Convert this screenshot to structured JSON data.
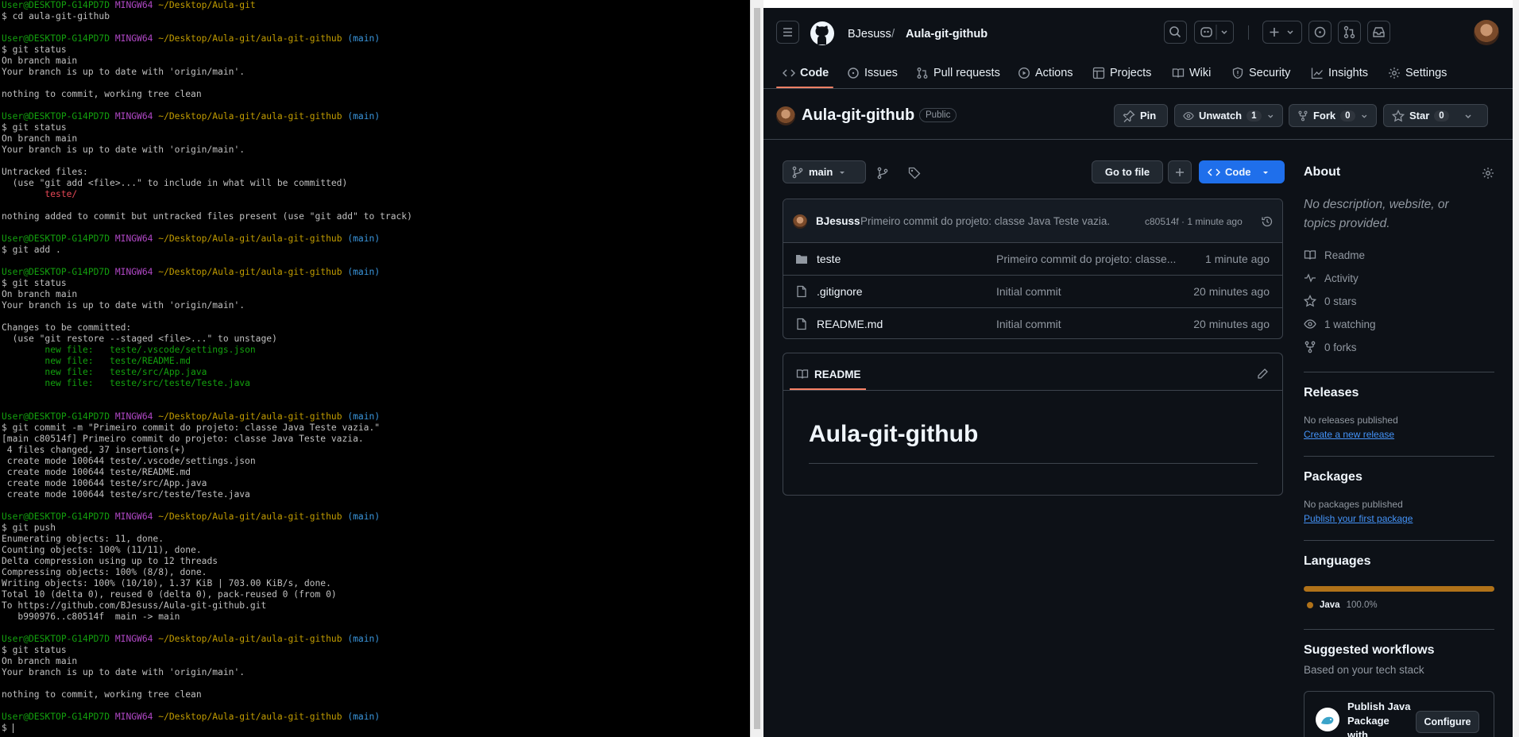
{
  "terminal": {
    "lines": [
      [
        {
          "t": "User@DESKTOP-G14PD7D",
          "c": "pg"
        },
        {
          "t": " "
        },
        {
          "t": "MINGW64",
          "c": "pp"
        },
        {
          "t": " "
        },
        {
          "t": "~/Desktop/Aula-git",
          "c": "py"
        }
      ],
      [
        {
          "t": "$ cd aula-git-github"
        }
      ],
      [
        {
          "t": ""
        }
      ],
      [
        {
          "t": "User@DESKTOP-G14PD7D",
          "c": "pg"
        },
        {
          "t": " "
        },
        {
          "t": "MINGW64",
          "c": "pp"
        },
        {
          "t": " "
        },
        {
          "t": "~/Desktop/Aula-git/aula-git-github",
          "c": "py"
        },
        {
          "t": " "
        },
        {
          "t": "(main)",
          "c": "pc"
        }
      ],
      [
        {
          "t": "$ git status"
        }
      ],
      [
        {
          "t": "On branch main"
        }
      ],
      [
        {
          "t": "Your branch is up to date with 'origin/main'."
        }
      ],
      [
        {
          "t": ""
        }
      ],
      [
        {
          "t": "nothing to commit, working tree clean"
        }
      ],
      [
        {
          "t": ""
        }
      ],
      [
        {
          "t": "User@DESKTOP-G14PD7D",
          "c": "pg"
        },
        {
          "t": " "
        },
        {
          "t": "MINGW64",
          "c": "pp"
        },
        {
          "t": " "
        },
        {
          "t": "~/Desktop/Aula-git/aula-git-github",
          "c": "py"
        },
        {
          "t": " "
        },
        {
          "t": "(main)",
          "c": "pc"
        }
      ],
      [
        {
          "t": "$ git status"
        }
      ],
      [
        {
          "t": "On branch main"
        }
      ],
      [
        {
          "t": "Your branch is up to date with 'origin/main'."
        }
      ],
      [
        {
          "t": ""
        }
      ],
      [
        {
          "t": "Untracked files:"
        }
      ],
      [
        {
          "t": "  (use \"git add <file>...\" to include in what will be committed)"
        }
      ],
      [
        {
          "t": "        "
        },
        {
          "t": "teste/",
          "c": "pr"
        }
      ],
      [
        {
          "t": ""
        }
      ],
      [
        {
          "t": "nothing added to commit but untracked files present (use \"git add\" to track)"
        }
      ],
      [
        {
          "t": ""
        }
      ],
      [
        {
          "t": "User@DESKTOP-G14PD7D",
          "c": "pg"
        },
        {
          "t": " "
        },
        {
          "t": "MINGW64",
          "c": "pp"
        },
        {
          "t": " "
        },
        {
          "t": "~/Desktop/Aula-git/aula-git-github",
          "c": "py"
        },
        {
          "t": " "
        },
        {
          "t": "(main)",
          "c": "pc"
        }
      ],
      [
        {
          "t": "$ git add ."
        }
      ],
      [
        {
          "t": ""
        }
      ],
      [
        {
          "t": "User@DESKTOP-G14PD7D",
          "c": "pg"
        },
        {
          "t": " "
        },
        {
          "t": "MINGW64",
          "c": "pp"
        },
        {
          "t": " "
        },
        {
          "t": "~/Desktop/Aula-git/aula-git-github",
          "c": "py"
        },
        {
          "t": " "
        },
        {
          "t": "(main)",
          "c": "pc"
        }
      ],
      [
        {
          "t": "$ git status"
        }
      ],
      [
        {
          "t": "On branch main"
        }
      ],
      [
        {
          "t": "Your branch is up to date with 'origin/main'."
        }
      ],
      [
        {
          "t": ""
        }
      ],
      [
        {
          "t": "Changes to be committed:"
        }
      ],
      [
        {
          "t": "  (use \"git restore --staged <file>...\" to unstage)"
        }
      ],
      [
        {
          "t": "        "
        },
        {
          "t": "new file:   teste/.vscode/settings.json",
          "c": "pg"
        }
      ],
      [
        {
          "t": "        "
        },
        {
          "t": "new file:   teste/README.md",
          "c": "pg"
        }
      ],
      [
        {
          "t": "        "
        },
        {
          "t": "new file:   teste/src/App.java",
          "c": "pg"
        }
      ],
      [
        {
          "t": "        "
        },
        {
          "t": "new file:   teste/src/teste/Teste.java",
          "c": "pg"
        }
      ],
      [
        {
          "t": ""
        }
      ],
      [
        {
          "t": ""
        }
      ],
      [
        {
          "t": "User@DESKTOP-G14PD7D",
          "c": "pg"
        },
        {
          "t": " "
        },
        {
          "t": "MINGW64",
          "c": "pp"
        },
        {
          "t": " "
        },
        {
          "t": "~/Desktop/Aula-git/aula-git-github",
          "c": "py"
        },
        {
          "t": " "
        },
        {
          "t": "(main)",
          "c": "pc"
        }
      ],
      [
        {
          "t": "$ git commit -m \"Primeiro commit do projeto: classe Java Teste vazia.\""
        }
      ],
      [
        {
          "t": "[main c80514f] Primeiro commit do projeto: classe Java Teste vazia."
        }
      ],
      [
        {
          "t": " 4 files changed, 37 insertions(+)"
        }
      ],
      [
        {
          "t": " create mode 100644 teste/.vscode/settings.json"
        }
      ],
      [
        {
          "t": " create mode 100644 teste/README.md"
        }
      ],
      [
        {
          "t": " create mode 100644 teste/src/App.java"
        }
      ],
      [
        {
          "t": " create mode 100644 teste/src/teste/Teste.java"
        }
      ],
      [
        {
          "t": ""
        }
      ],
      [
        {
          "t": "User@DESKTOP-G14PD7D",
          "c": "pg"
        },
        {
          "t": " "
        },
        {
          "t": "MINGW64",
          "c": "pp"
        },
        {
          "t": " "
        },
        {
          "t": "~/Desktop/Aula-git/aula-git-github",
          "c": "py"
        },
        {
          "t": " "
        },
        {
          "t": "(main)",
          "c": "pc"
        }
      ],
      [
        {
          "t": "$ git push"
        }
      ],
      [
        {
          "t": "Enumerating objects: 11, done."
        }
      ],
      [
        {
          "t": "Counting objects: 100% (11/11), done."
        }
      ],
      [
        {
          "t": "Delta compression using up to 12 threads"
        }
      ],
      [
        {
          "t": "Compressing objects: 100% (8/8), done."
        }
      ],
      [
        {
          "t": "Writing objects: 100% (10/10), 1.37 KiB | 703.00 KiB/s, done."
        }
      ],
      [
        {
          "t": "Total 10 (delta 0), reused 0 (delta 0), pack-reused 0 (from 0)"
        }
      ],
      [
        {
          "t": "To https://github.com/BJesuss/Aula-git-github.git"
        }
      ],
      [
        {
          "t": "   b990976..c80514f  main -> main"
        }
      ],
      [
        {
          "t": ""
        }
      ],
      [
        {
          "t": "User@DESKTOP-G14PD7D",
          "c": "pg"
        },
        {
          "t": " "
        },
        {
          "t": "MINGW64",
          "c": "pp"
        },
        {
          "t": " "
        },
        {
          "t": "~/Desktop/Aula-git/aula-git-github",
          "c": "py"
        },
        {
          "t": " "
        },
        {
          "t": "(main)",
          "c": "pc"
        }
      ],
      [
        {
          "t": "$ git status"
        }
      ],
      [
        {
          "t": "On branch main"
        }
      ],
      [
        {
          "t": "Your branch is up to date with 'origin/main'."
        }
      ],
      [
        {
          "t": ""
        }
      ],
      [
        {
          "t": "nothing to commit, working tree clean"
        }
      ],
      [
        {
          "t": ""
        }
      ],
      [
        {
          "t": "User@DESKTOP-G14PD7D",
          "c": "pg"
        },
        {
          "t": " "
        },
        {
          "t": "MINGW64",
          "c": "pp"
        },
        {
          "t": " "
        },
        {
          "t": "~/Desktop/Aula-git/aula-git-github",
          "c": "py"
        },
        {
          "t": " "
        },
        {
          "t": "(main)",
          "c": "pc"
        }
      ],
      [
        {
          "t": "$ "
        }
      ]
    ]
  },
  "github": {
    "header": {
      "owner": "BJesuss",
      "separator": "/",
      "repo": "Aula-git-github"
    },
    "tabs": [
      {
        "label": "Code",
        "icon": "code-icon"
      },
      {
        "label": "Issues",
        "icon": "issue-icon"
      },
      {
        "label": "Pull requests",
        "icon": "pull-request-icon"
      },
      {
        "label": "Actions",
        "icon": "play-icon"
      },
      {
        "label": "Projects",
        "icon": "table-icon"
      },
      {
        "label": "Wiki",
        "icon": "book-icon"
      },
      {
        "label": "Security",
        "icon": "shield-icon"
      },
      {
        "label": "Insights",
        "icon": "graph-icon"
      },
      {
        "label": "Settings",
        "icon": "gear-icon"
      }
    ],
    "repo_title": "Aula-git-github",
    "visibility": "Public",
    "actions": {
      "pin": "Pin",
      "unwatch": "Unwatch",
      "watch_count": "1",
      "fork": "Fork",
      "fork_count": "0",
      "star": "Star",
      "star_count": "0"
    },
    "toolbar": {
      "branch": "main",
      "goto": "Go to file",
      "code": "Code"
    },
    "commit": {
      "author": "BJesuss",
      "message": "Primeiro commit do projeto: classe Java Teste vazia.",
      "meta": "c80514f · 1 minute ago"
    },
    "files": [
      {
        "name": "teste",
        "type": "folder",
        "message": "Primeiro commit do projeto: classe...",
        "time": "1 minute ago"
      },
      {
        "name": ".gitignore",
        "type": "file",
        "message": "Initial commit",
        "time": "20 minutes ago"
      },
      {
        "name": "README.md",
        "type": "file",
        "message": "Initial commit",
        "time": "20 minutes ago"
      }
    ],
    "readme": {
      "tab": "README",
      "heading": "Aula-git-github"
    },
    "about": {
      "title": "About",
      "description": "No description, website, or topics provided.",
      "items": [
        {
          "icon": "book-icon",
          "label": "Readme"
        },
        {
          "icon": "pulse-icon",
          "label": "Activity"
        },
        {
          "icon": "star-icon",
          "label": "0 stars"
        },
        {
          "icon": "eye-icon",
          "label": "1 watching"
        },
        {
          "icon": "fork-icon",
          "label": "0 forks"
        }
      ]
    },
    "releases": {
      "title": "Releases",
      "empty": "No releases published",
      "link": "Create a new release"
    },
    "packages": {
      "title": "Packages",
      "empty": "No packages published",
      "link": "Publish your first package"
    },
    "languages": {
      "title": "Languages",
      "name": "Java",
      "percent": "100.0%",
      "color": "#b07219",
      "fraction": 1.0
    },
    "workflows": {
      "title": "Suggested workflows",
      "subtitle": "Based on your tech stack",
      "card_title": "Publish Java Package with",
      "configure": "Configure"
    }
  }
}
